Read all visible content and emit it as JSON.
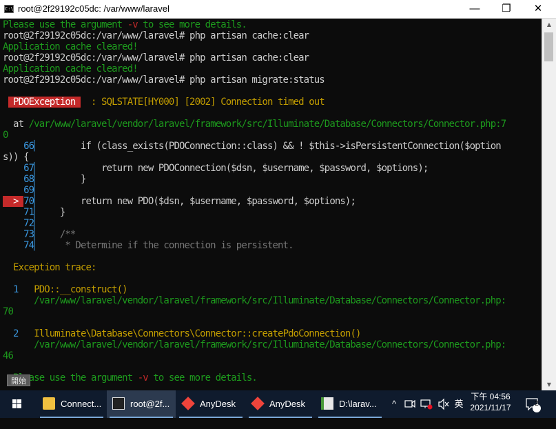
{
  "window": {
    "title": "root@2f29192c05dc: /var/www/laravel",
    "app_icon_text": "C:\\",
    "minimize_glyph": "—",
    "maximize_glyph": "❐",
    "close_glyph": "✕"
  },
  "terminal": {
    "lines": [
      [
        [
          "Please use the argument ",
          "#1d9a1d"
        ],
        [
          "-v",
          "#c42a2a"
        ],
        [
          " to see more details.",
          "#1d9a1d"
        ]
      ],
      [
        [
          "root@2f29192c05dc:/var/www/laravel# php artisan cache:clear",
          "#cccccc"
        ]
      ],
      [
        [
          "Application cache cleared!",
          "#1d9a1d"
        ]
      ],
      [
        [
          "root@2f29192c05dc:/var/www/laravel# php artisan cache:clear",
          "#cccccc"
        ]
      ],
      [
        [
          "Application cache cleared!",
          "#1d9a1d"
        ]
      ],
      [
        [
          "root@2f29192c05dc:/var/www/laravel# php artisan migrate:status",
          "#cccccc"
        ]
      ],
      [],
      [
        [
          " ",
          "#cccccc"
        ],
        [
          " PDOException ",
          "#ffffff",
          "#c42a2a"
        ],
        [
          "  : SQLSTATE[HY000] [2002] Connection timed out",
          "#c19c00"
        ]
      ],
      [],
      [
        [
          "  at ",
          "#cccccc"
        ],
        [
          "/var/www/laravel/vendor/laravel/framework/src/Illuminate/Database/Connectors/Connector.php",
          "#1d9a1d"
        ],
        [
          ":7",
          "#1d9a1d"
        ]
      ],
      [
        [
          "0",
          "#1d9a1d"
        ]
      ],
      [
        [
          "    66",
          "#3a96dd"
        ],
        [
          "▏",
          "#3a96dd"
        ],
        [
          "        if (class_exists(PDOConnection::class) && ! $this->isPersistentConnection($option",
          "#cccccc"
        ]
      ],
      [
        [
          "s)) {",
          "#cccccc"
        ]
      ],
      [
        [
          "    67",
          "#3a96dd"
        ],
        [
          "▏",
          "#3a96dd"
        ],
        [
          "            return new PDOConnection($dsn, $username, $password, $options);",
          "#cccccc"
        ]
      ],
      [
        [
          "    68",
          "#3a96dd"
        ],
        [
          "▏",
          "#3a96dd"
        ],
        [
          "        }",
          "#cccccc"
        ]
      ],
      [
        [
          "    69",
          "#3a96dd"
        ],
        [
          "▏",
          "#3a96dd"
        ]
      ],
      [
        [
          "  > ",
          "#ffffff",
          "#c42a2a"
        ],
        [
          "70",
          "#3a96dd"
        ],
        [
          "▏",
          "#3a96dd"
        ],
        [
          "        return new PDO($dsn, $username, $password, $options);",
          "#cccccc"
        ]
      ],
      [
        [
          "    71",
          "#3a96dd"
        ],
        [
          "▏",
          "#3a96dd"
        ],
        [
          "    }",
          "#cccccc"
        ]
      ],
      [
        [
          "    72",
          "#3a96dd"
        ],
        [
          "▏",
          "#3a96dd"
        ]
      ],
      [
        [
          "    73",
          "#3a96dd"
        ],
        [
          "▏",
          "#3a96dd"
        ],
        [
          "    /**",
          "#767676"
        ]
      ],
      [
        [
          "    74",
          "#3a96dd"
        ],
        [
          "▏",
          "#3a96dd"
        ],
        [
          "     * Determine if the connection is persistent.",
          "#767676"
        ]
      ],
      [],
      [
        [
          "  Exception trace:",
          "#c19c00"
        ]
      ],
      [],
      [
        [
          "  1   ",
          "#3a96dd"
        ],
        [
          "PDO::__construct()",
          "#c19c00"
        ]
      ],
      [
        [
          "      /var/www/laravel/vendor/laravel/framework/src/Illuminate/Database/Connectors/Connector.php:",
          "#1d9a1d"
        ]
      ],
      [
        [
          "70",
          "#1d9a1d"
        ]
      ],
      [],
      [
        [
          "  2   ",
          "#3a96dd"
        ],
        [
          "Illuminate\\Database\\Connectors\\Connector::createPdoConnection()",
          "#c19c00"
        ]
      ],
      [
        [
          "      /var/www/laravel/vendor/laravel/framework/src/Illuminate/Database/Connectors/Connector.php:",
          "#1d9a1d"
        ]
      ],
      [
        [
          "46",
          "#1d9a1d"
        ]
      ],
      [],
      [
        [
          "  Please use the argument ",
          "#1d9a1d"
        ],
        [
          "-v",
          "#c42a2a"
        ],
        [
          " to see more details.",
          "#1d9a1d"
        ]
      ]
    ]
  },
  "scrollbar": {
    "up_glyph": "▲",
    "down_glyph": "▼"
  },
  "ime_indicator": "開始",
  "taskbar": {
    "start_icon": "windows-logo-icon",
    "buttons": [
      {
        "label": "Connect...",
        "icon": "folder-icon",
        "color": "#f0c040"
      },
      {
        "label": "root@2f...",
        "icon": "terminal-icon",
        "color": "#222222"
      },
      {
        "label": "AnyDesk",
        "icon": "anydesk-icon",
        "color": "#ef443b"
      },
      {
        "label": "AnyDesk",
        "icon": "anydesk-icon",
        "color": "#ef443b"
      },
      {
        "label": "D:\\larav...",
        "icon": "notepad-icon",
        "color": "#4a9a3a"
      }
    ],
    "tray_chevron": "^",
    "ime_lang": "英",
    "clock_time": "下午 04:56",
    "clock_date": "2021/11/17",
    "notification_count": "2"
  }
}
